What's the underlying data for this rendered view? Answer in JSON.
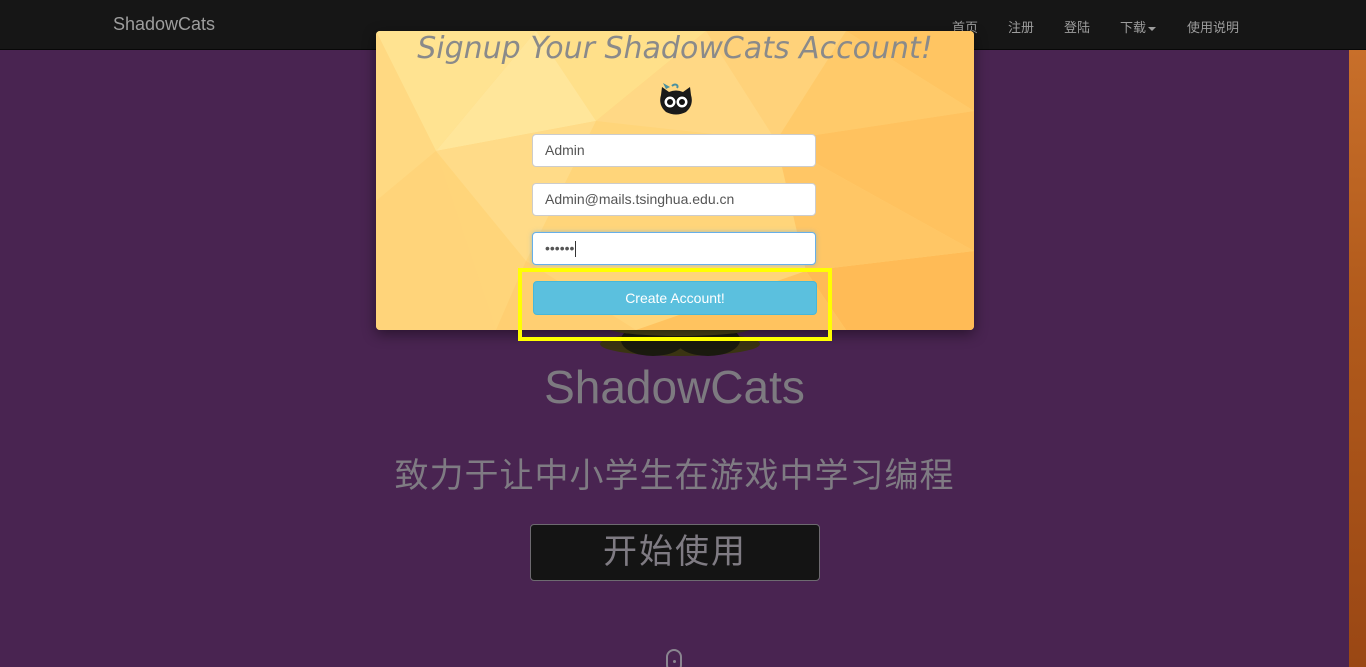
{
  "navbar": {
    "brand": "ShadowCats",
    "items": [
      {
        "label": "首页"
      },
      {
        "label": "注册"
      },
      {
        "label": "登陆"
      },
      {
        "label": "下载"
      },
      {
        "label": "使用说明"
      }
    ]
  },
  "hero": {
    "title": "ShadowCats",
    "subtitle": "致力于让中小学生在游戏中学习编程",
    "start_button": "开始使用"
  },
  "modal": {
    "title": "Signup Your ShadowCats Account!",
    "username_value": "Admin",
    "email_value": "Admin@mails.tsinghua.edu.cn",
    "password_value": "••••••",
    "submit_label": "Create Account!"
  },
  "colors": {
    "page_background": "#492451",
    "navbar_background": "#161616",
    "submit_button": "#5bc0de",
    "highlight": "#ffff00"
  },
  "icons": {
    "modal_logo": "cat-face-icon",
    "hero_logo": "cat-eyes-logo",
    "scroll_hint": "mouse-scroll-icon",
    "dropdown": "caret-down-icon"
  }
}
